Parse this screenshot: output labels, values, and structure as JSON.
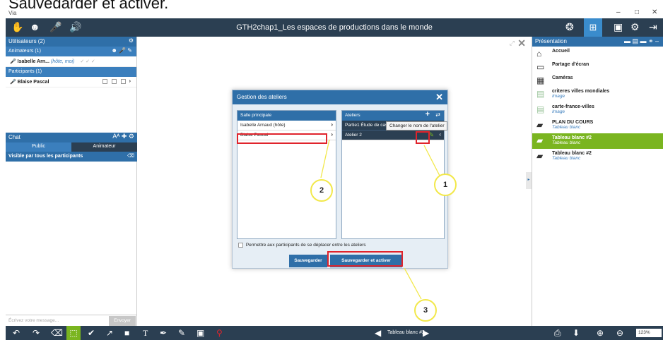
{
  "caption": "Sauvegarder et activer.",
  "window": {
    "app_name": "Via",
    "minimize": "–",
    "maximize": "□",
    "close": "✕"
  },
  "topbar": {
    "title": "GTH2chap1_Les espaces de productions dans le monde",
    "left_icons": [
      "hand-icon",
      "user-icon",
      "microphone-icon",
      "speaker-icon"
    ],
    "right_icons": [
      "settings-wheel-icon",
      "network-icon",
      "layout-icon",
      "gear-icon",
      "exit-icon"
    ]
  },
  "users": {
    "header": "Utilisateurs (2)",
    "animateurs_header": "Animateurs (1)",
    "animateurs": [
      {
        "name": "Isabelle Arn...",
        "tag": "(hôte, moi)"
      }
    ],
    "participants_header": "Participants (1)",
    "participants": [
      {
        "name": "Blaise Pascal"
      }
    ]
  },
  "chat": {
    "header": "Chat",
    "tabs": [
      "Public",
      "Animateur"
    ],
    "visibility": "Visible par tous les participants",
    "placeholder": "Écrivez votre message...",
    "send": "Envoyer"
  },
  "presentation": {
    "header": "Présentation",
    "items": [
      {
        "label": "Accueil",
        "sub": ""
      },
      {
        "label": "Partage d'écran",
        "sub": ""
      },
      {
        "label": "Caméras",
        "sub": ""
      },
      {
        "label": "criteres villes mondiales",
        "sub": "Image"
      },
      {
        "label": "carte-france-villes",
        "sub": "Image"
      },
      {
        "label": "PLAN DU COURS",
        "sub": "Tableau blanc"
      },
      {
        "label": "Tableau blanc #2",
        "sub": "Tableau blanc"
      },
      {
        "label": "Tableau blanc #2",
        "sub": "Tableau blanc"
      }
    ]
  },
  "dialog": {
    "title": "Gestion des ateliers",
    "main_room_header": "Salle principale",
    "main_room_people": [
      "Isabelle Arnaud (hôte)",
      "Blaise Pascal"
    ],
    "ateliers_header": "Ateliers",
    "ateliers": [
      "Partie1 Étude de cas",
      "Atelier 2"
    ],
    "tooltip": "Changer le nom de l'atelier",
    "checkbox_label": "Permettre aux participants de se déplacer entre les ateliers",
    "save": "Sauvegarder",
    "save_activate": "Sauvegarder et activer"
  },
  "callouts": [
    "1",
    "2",
    "3"
  ],
  "bottombar": {
    "page_label": "Tableau blanc #2",
    "zoom": "123%"
  },
  "colors": {
    "topbar": "#2b3f52",
    "accent": "#2f6fa8",
    "active": "#7ab520",
    "highlight": "#e0242c",
    "callout": "#f2e84a"
  }
}
